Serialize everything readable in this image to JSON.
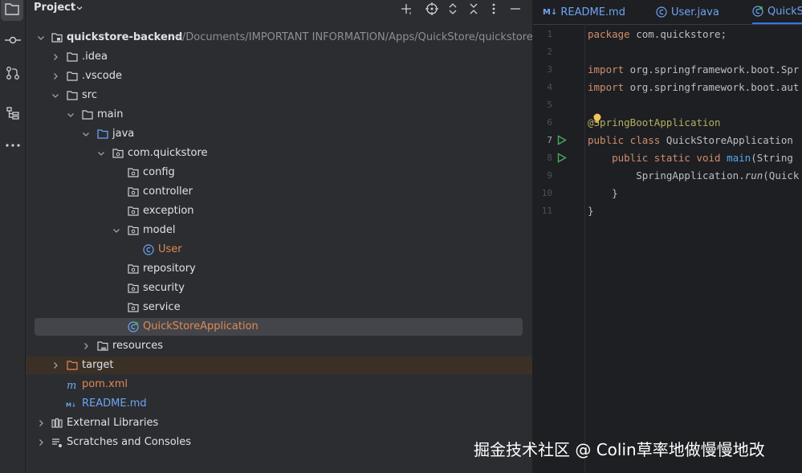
{
  "panel": {
    "title": "Project"
  },
  "tree": [
    {
      "label": "quickstore-backend",
      "path": "~/Documents/IMPORTANT INFORMATION/Apps/QuickStore/quickstore-",
      "bold": true
    },
    {
      "label": ".idea"
    },
    {
      "label": ".vscode"
    },
    {
      "label": "src"
    },
    {
      "label": "main"
    },
    {
      "label": "java"
    },
    {
      "label": "com.quickstore"
    },
    {
      "label": "config"
    },
    {
      "label": "controller"
    },
    {
      "label": "exception"
    },
    {
      "label": "model"
    },
    {
      "label": "User"
    },
    {
      "label": "repository"
    },
    {
      "label": "security"
    },
    {
      "label": "service"
    },
    {
      "label": "QuickStoreApplication"
    },
    {
      "label": "resources"
    },
    {
      "label": "target"
    },
    {
      "label": "pom.xml"
    },
    {
      "label": "README.md"
    },
    {
      "label": "External Libraries"
    },
    {
      "label": "Scratches and Consoles"
    }
  ],
  "tabs": [
    {
      "label": "README.md",
      "icon": "markdown-icon"
    },
    {
      "label": "User.java",
      "icon": "class-icon"
    },
    {
      "label": "QuickS",
      "icon": "spring-class-icon"
    }
  ],
  "editor": {
    "line_numbers": [
      "1",
      "2",
      "3",
      "4",
      "5",
      "6",
      "7",
      "8",
      "9",
      "10",
      "11"
    ],
    "lines": {
      "l1_kw": "package",
      "l1_rest": " com.quickstore;",
      "l3_kw": "import",
      "l3_rest": " org.springframework.boot.Spr",
      "l4_kw": "import",
      "l4_rest": " org.springframework.boot.aut",
      "l6_at": "@",
      "l6_ann": "SpringBootApplication",
      "l7_kw": "public class",
      "l7_rest": " QuickStoreApplication",
      "l8_kw": "public static void",
      "l8_fn": " main",
      "l8_rest": "(String",
      "l9_a": "SpringApplication.",
      "l9_run": "run",
      "l9_b": "(Quick",
      "l10": "}",
      "l11": "}"
    }
  },
  "watermark": "掘金技术社区 @ Colin草率地做慢慢地改",
  "colors": {
    "accent": "#3574f0",
    "modified_file": "#e08855",
    "run_gutter": "#4aa85c"
  }
}
